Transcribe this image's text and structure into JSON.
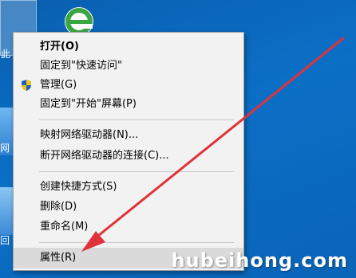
{
  "desktop": {
    "icons": [
      {
        "label": "此"
      },
      {
        "label": "网"
      },
      {
        "label": "回"
      }
    ]
  },
  "context_menu": {
    "items": [
      {
        "label": "打开(O)",
        "bold": true
      },
      {
        "label": "固定到\"快速访问\""
      },
      {
        "label": "管理(G)",
        "icon": "shield-icon"
      },
      {
        "label": "固定到\"开始\"屏幕(P)"
      },
      {
        "label": "映射网络驱动器(N)..."
      },
      {
        "label": "断开网络驱动器的连接(C)..."
      },
      {
        "label": "创建快捷方式(S)"
      },
      {
        "label": "删除(D)"
      },
      {
        "label": "重命名(M)"
      },
      {
        "label": "属性(R)",
        "highlighted": true
      }
    ]
  },
  "watermark": "hubeihong.com",
  "colors": {
    "desktop_bg": "#0b6fc6",
    "menu_bg": "#f2f2f2",
    "highlight_bg": "#dadada",
    "arrow": "#e0323a"
  },
  "icons": [
    "edge-ie-icon",
    "this-pc-icon",
    "network-icon",
    "recycle-bin-icon",
    "shield-icon",
    "red-arrow"
  ]
}
